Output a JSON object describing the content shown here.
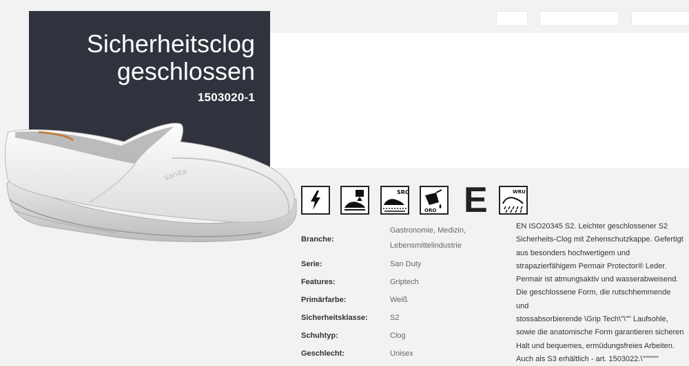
{
  "product": {
    "title_line1": "Sicherheitsclog",
    "title_line2": "geschlossen",
    "sku": "1503020-1",
    "shoe_logo": "sanita"
  },
  "icons": [
    {
      "name": "electrical-hazard-icon"
    },
    {
      "name": "toe-cap-icon"
    },
    {
      "name": "src-slip-resistance-icon",
      "label": "SRC"
    },
    {
      "name": "oil-resistant-icon",
      "label": "ORO"
    },
    {
      "name": "energy-absorption-icon",
      "label": "E"
    },
    {
      "name": "water-resistant-icon",
      "label": "WRU"
    }
  ],
  "specs": {
    "branche_label": "Branche:",
    "branche_value_line1": "Gastronomie, Medizin,",
    "branche_value_line2": "Lebensmittelindustrie",
    "serie_label": "Serie:",
    "serie_value": "San Duty",
    "features_label": "Features:",
    "features_value": "Griptech",
    "farbe_label": "Primärfarbe:",
    "farbe_value": "Weiß",
    "klasse_label": "Sicherheitsklasse:",
    "klasse_value": "S2",
    "typ_label": "Schuhtyp:",
    "typ_value": "Clog",
    "geschlecht_label": "Geschlecht:",
    "geschlecht_value": "Unisex"
  },
  "description": {
    "lines": [
      "EN ISO20345 S2. Leichter geschlossener S2",
      "Sicherheits-Clog mit Zehenschutzkappe. Gefertigt",
      "aus besonders hochwertigem und",
      "strapazierfähigem Permair Protector® Leder.",
      "Permair ist atmungsaktiv und wasserabweisend.",
      "Die geschlossene Form, die rutschhemmende und",
      "stossabsorbierende \\Grip Tech\\\"\\\"\" Laufsohle,",
      "sowie die anatomische Form garantieren sicheren",
      "Halt und bequemes, ermüdungsfreies Arbeiten.",
      "Auch als S3 erhältlich - art. 1503022.\\\"\"\"\"\"\""
    ]
  }
}
